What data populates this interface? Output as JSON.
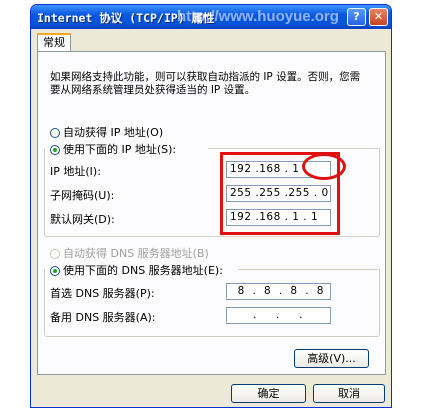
{
  "window": {
    "title": "Internet 协议 (TCP/IP) 属性",
    "watermark": "http://www.huoyue.org",
    "help_glyph": "?",
    "close_glyph": "✕"
  },
  "tabs": [
    {
      "label": "常规"
    }
  ],
  "intro_text": "如果网络支持此功能，则可以获取自动指派的 IP 设置。否则，您需要从网络系统管理员处获得适当的 IP 设置。",
  "ip": {
    "auto_label": "自动获得 IP 地址(O)",
    "manual_label": "使用下面的 IP 地址(S):",
    "selected": "manual",
    "fields": [
      {
        "label": "IP 地址(I):",
        "value": "192 .168 . 1 .   "
      },
      {
        "label": "子网掩码(U):",
        "value": "255 .255 .255 . 0"
      },
      {
        "label": "默认网关(D):",
        "value": "192 .168 . 1 . 1"
      }
    ]
  },
  "dns": {
    "auto_label": "自动获得 DNS 服务器地址(B)",
    "manual_label": "使用下面的 DNS 服务器地址(E):",
    "selected": "manual",
    "fields": [
      {
        "label": "首选 DNS 服务器(P):",
        "value": "  8  .  8  .  8  .  8"
      },
      {
        "label": "备用 DNS 服务器(A):",
        "value": "      .     .     .  "
      }
    ]
  },
  "buttons": {
    "advanced": "高级(V)...",
    "ok": "确定",
    "cancel": "取消"
  },
  "colors": {
    "highlight_red": "#e01010",
    "titlebar_blue": "#0553d9"
  }
}
